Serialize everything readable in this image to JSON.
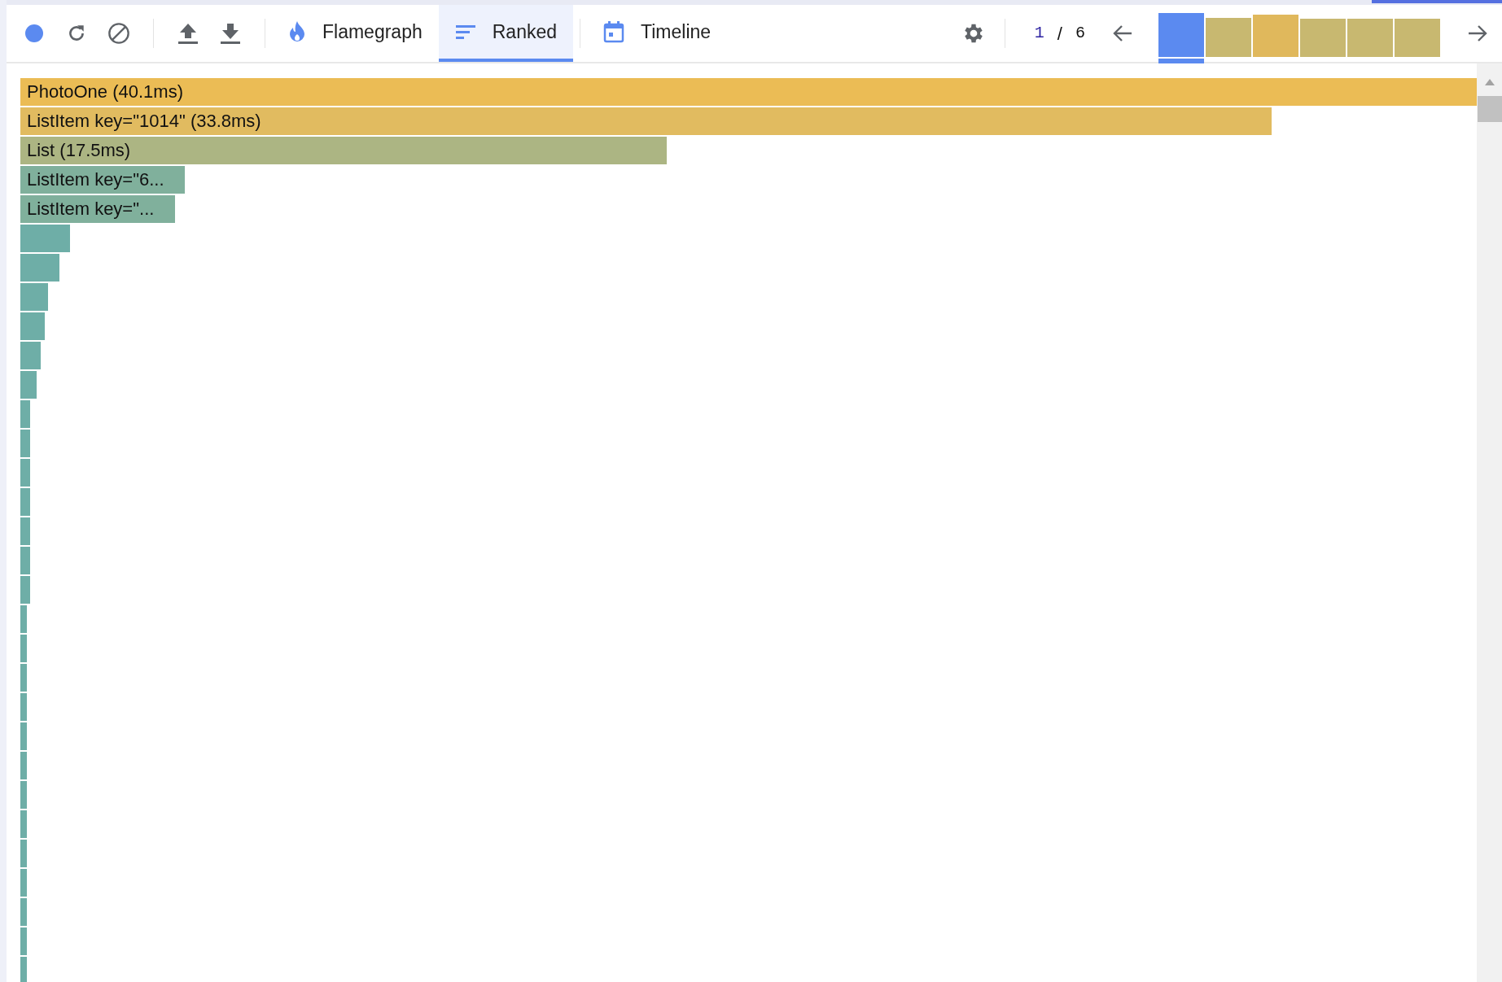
{
  "tabs": [
    {
      "label": "Flamegraph",
      "kind": "flame",
      "selected": false
    },
    {
      "label": "Ranked",
      "kind": "ranked",
      "selected": true
    },
    {
      "label": "Timeline",
      "kind": "calendar",
      "selected": false
    }
  ],
  "commit_counter": {
    "current": "1",
    "separator": "/",
    "total": "6"
  },
  "commits": [
    {
      "color": "#5b8af0",
      "selected": true
    },
    {
      "color": "#c8b870",
      "selected": false
    },
    {
      "color": "#e0b85c",
      "selected": false
    },
    {
      "color": "#c8b870",
      "selected": false
    },
    {
      "color": "#c8b870",
      "selected": false
    },
    {
      "color": "#c8b870",
      "selected": false
    }
  ],
  "rows": [
    {
      "label": "PhotoOne (40.1ms)",
      "level": 1,
      "color": "#ebbc55"
    },
    {
      "label": "ListItem key=\"1014\" (33.8ms)",
      "level": 0.859,
      "color": "#e1bb60"
    },
    {
      "label": "List (17.5ms)",
      "level": 0.444,
      "color": "#acb583"
    },
    {
      "label": "ListItem key=\"6...",
      "level": 0.113,
      "color": "#80b09c"
    },
    {
      "label": "ListItem key=\"...",
      "level": 0.106,
      "color": "#80b09c"
    },
    {
      "level": 0.034,
      "color": "#6eaea7"
    },
    {
      "level": 0.027,
      "color": "#6eaea7"
    },
    {
      "level": 0.019,
      "color": "#6eaea7"
    },
    {
      "level": 0.0165,
      "color": "#6eaea7"
    },
    {
      "level": 0.014,
      "color": "#6eaea7"
    },
    {
      "level": 0.011,
      "color": "#6eaea7"
    },
    {
      "level": 0.0066,
      "color": "#6eaea7"
    },
    {
      "level": 0.0066,
      "color": "#6eaea7"
    },
    {
      "level": 0.0066,
      "color": "#6eaea7"
    },
    {
      "level": 0.0066,
      "color": "#6eaea7"
    },
    {
      "level": 0.0066,
      "color": "#6eaea7"
    },
    {
      "level": 0.0066,
      "color": "#6eaea7"
    },
    {
      "level": 0.0066,
      "color": "#6eaea7"
    },
    {
      "level": 0.0046,
      "color": "#6eaea7"
    },
    {
      "level": 0.0046,
      "color": "#6eaea7"
    },
    {
      "level": 0.0046,
      "color": "#6eaea7"
    },
    {
      "level": 0.0046,
      "color": "#6eaea7"
    },
    {
      "level": 0.0046,
      "color": "#6eaea7"
    },
    {
      "level": 0.0046,
      "color": "#6eaea7"
    },
    {
      "level": 0.0046,
      "color": "#6eaea7"
    },
    {
      "level": 0.0046,
      "color": "#6eaea7"
    },
    {
      "level": 0.0046,
      "color": "#6eaea7"
    },
    {
      "level": 0.0046,
      "color": "#6eaea7"
    },
    {
      "level": 0.0046,
      "color": "#6eaea7"
    },
    {
      "level": 0.0046,
      "color": "#6eaea7"
    },
    {
      "level": 0.0046,
      "color": "#6eaea7"
    }
  ]
}
